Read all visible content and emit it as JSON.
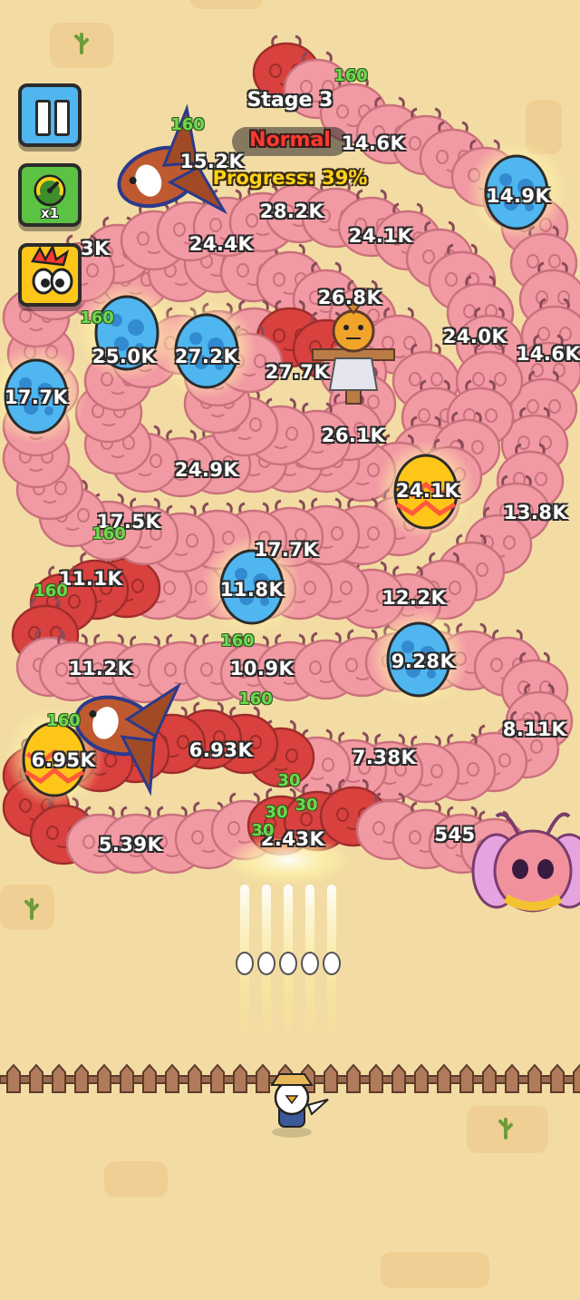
{
  "hud": {
    "stage": "Stage 3",
    "difficulty": "Normal",
    "progress_text": "Progress: 39%",
    "progress": 0.39,
    "speed_label": "x1",
    "buttons": {
      "pause": "pause-icon",
      "speed": "speedometer-icon",
      "boost": "angry-bird-icon"
    }
  },
  "colors": {
    "ground": "#f3dca4",
    "enemy_body": "#f29aa3",
    "enemy_damaged": "#d9413e",
    "egg_blue": "#4fb6ef",
    "egg_gold": "#ffc61a",
    "popup_green": "#6fd84f"
  },
  "damage_numbers": [
    "14.6K",
    "15.2K",
    "14.9K",
    "3K",
    "28.2K",
    "24.4K",
    "24.1K",
    "26.8K",
    "24.0K",
    "14.6K",
    "25.0K",
    "27.2K",
    "17.7K",
    "27.7K",
    "26.1K",
    "24.9K",
    "24.1K",
    "13.8K",
    "17.5K",
    "17.7K",
    "11.1K",
    "11.8K",
    "12.2K",
    "9.28K",
    "11.2K",
    "10.9K",
    "8.11K",
    "6.95K",
    "6.93K",
    "7.38K",
    "5.39K",
    "2.43K",
    "545"
  ],
  "popups": [
    "160",
    "160",
    "160",
    "160",
    "160",
    "160",
    "160",
    "160",
    "30",
    "30",
    "30",
    "30"
  ]
}
